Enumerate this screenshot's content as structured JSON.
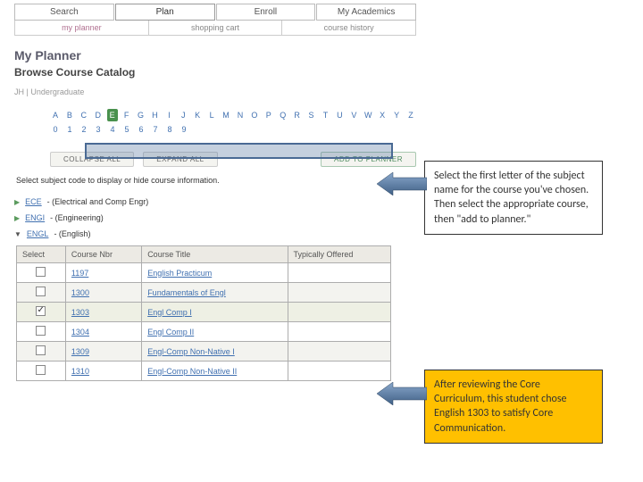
{
  "tabs": [
    "Search",
    "Plan",
    "Enroll",
    "My Academics"
  ],
  "subtabs": [
    "my planner",
    "shopping cart",
    "course history"
  ],
  "title": "My Planner",
  "subtitle": "Browse Course Catalog",
  "crumb": "JH | Undergraduate",
  "alpha1": [
    "A",
    "B",
    "C",
    "D",
    "E",
    "F",
    "G",
    "H",
    "I",
    "J",
    "K",
    "L",
    "M",
    "N",
    "O",
    "P",
    "Q",
    "R",
    "S",
    "T",
    "U",
    "V",
    "W",
    "X",
    "Y",
    "Z"
  ],
  "alpha2": [
    "0",
    "1",
    "2",
    "3",
    "4",
    "5",
    "6",
    "7",
    "8",
    "9"
  ],
  "alpha_sel": "E",
  "btn_collapse": "COLLAPSE ALL",
  "btn_expand": "EXPAND ALL",
  "btn_add": "ADD TO PLANNER",
  "note": "Select subject code to display or hide course information.",
  "subjects": [
    {
      "tri": "▶",
      "code": "ECE",
      "name": "ECE (Electrical and Comp Engr)"
    },
    {
      "tri": "▶",
      "code": "ENGI",
      "name": "ENGI (Engineering)"
    },
    {
      "tri": "▼",
      "code": "ENGL",
      "name": "ENGL (English)",
      "open": true
    }
  ],
  "thead": [
    "Select",
    "Course Nbr",
    "Course Title",
    "Typically Offered"
  ],
  "rows": [
    {
      "nbr": "1197",
      "title": "English Practicum",
      "sel": false,
      "alt": false
    },
    {
      "nbr": "1300",
      "title": "Fundamentals of Engl",
      "sel": false,
      "alt": true
    },
    {
      "nbr": "1303",
      "title": "Engl Comp I",
      "sel": true,
      "alt": false
    },
    {
      "nbr": "1304",
      "title": "Engl Comp II",
      "sel": false,
      "alt": false
    },
    {
      "nbr": "1309",
      "title": "Engl-Comp Non-Native I",
      "sel": false,
      "alt": true
    },
    {
      "nbr": "1310",
      "title": "Engl-Comp Non-Native II",
      "sel": false,
      "alt": false
    }
  ],
  "callout1": "Select the first letter of the subject name for the course you've chosen. Then select the appropriate course, then \"add to planner.\"",
  "callout2": "After reviewing the Core Curriculum, this student chose English 1303 to satisfy Core Communication."
}
